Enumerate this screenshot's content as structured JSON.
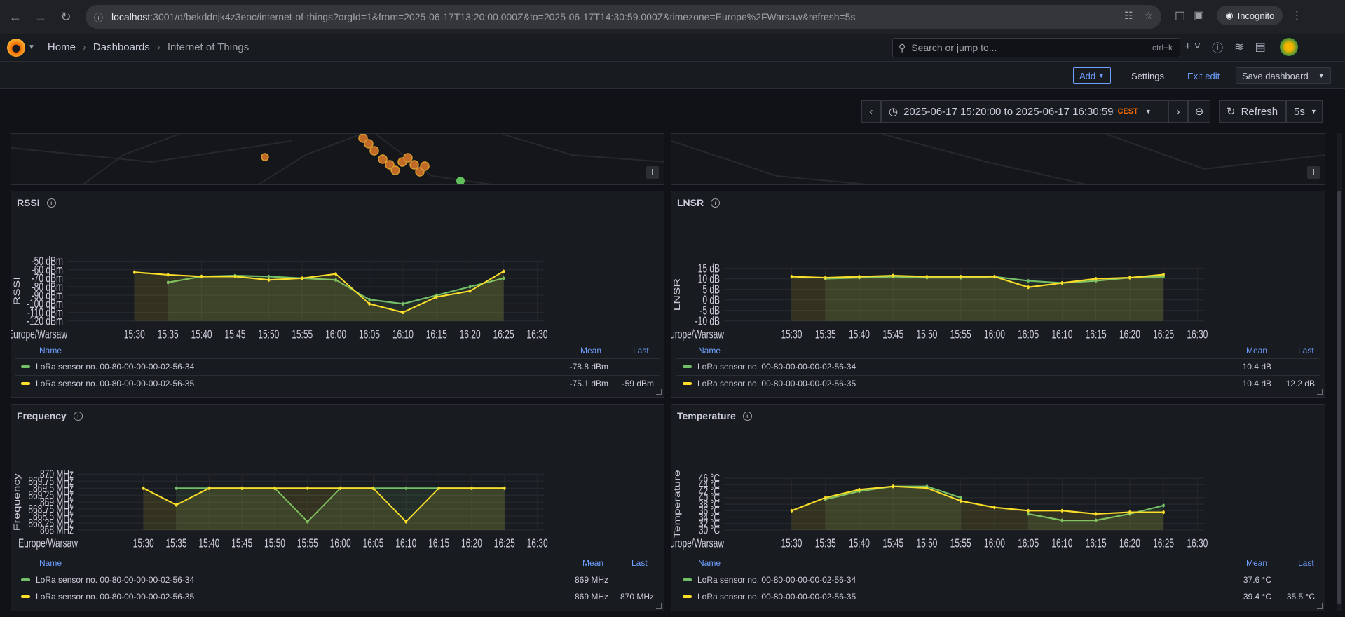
{
  "browser": {
    "url_host": "localhost",
    "url_rest": ":3001/d/bekddnjk4z3eoc/internet-of-things?orgId=1&from=2025-06-17T13:20:00.000Z&to=2025-06-17T14:30:59.000Z&timezone=Europe%2FWarsaw&refresh=5s",
    "incognito_label": "Incognito"
  },
  "nav": {
    "breadcrumbs": [
      "Home",
      "Dashboards",
      "Internet of Things"
    ],
    "search_placeholder": "Search or jump to...",
    "search_shortcut": "ctrl+k"
  },
  "toolbar": {
    "add_label": "Add",
    "settings_label": "Settings",
    "exit_label": "Exit edit",
    "save_label": "Save dashboard"
  },
  "timepicker": {
    "range": "2025-06-17 15:20:00 to 2025-06-17 16:30:59",
    "timezone": "CEST",
    "refresh_label": "Refresh",
    "refresh_interval": "5s"
  },
  "colors": {
    "series_34": "#73bf69",
    "series_35": "#fade2a",
    "link": "#6e9fff",
    "accent": "#f46800"
  },
  "x_axis": {
    "zone_label": "Europe/Warsaw",
    "ticks": [
      "15:30",
      "15:35",
      "15:40",
      "15:45",
      "15:50",
      "15:55",
      "16:00",
      "16:05",
      "16:10",
      "16:15",
      "16:20",
      "16:25",
      "16:30"
    ]
  },
  "legend_headers": {
    "name": "Name",
    "mean": "Mean",
    "last": "Last"
  },
  "panels": {
    "rssi": {
      "title": "RSSI",
      "ylabel": "RSSI",
      "yticks": [
        "-50 dBm",
        "-60 dBm",
        "-70 dBm",
        "-80 dBm",
        "-90 dBm",
        "-100 dBm",
        "-110 dBm",
        "-120 dBm"
      ],
      "legend": [
        {
          "name": "LoRa sensor no. 00-80-00-00-00-02-56-34",
          "mean": "-78.8 dBm",
          "last": ""
        },
        {
          "name": "LoRa sensor no. 00-80-00-00-00-02-56-35",
          "mean": "-75.1 dBm",
          "last": "-59 dBm"
        }
      ]
    },
    "lnsr": {
      "title": "LNSR",
      "ylabel": "LNSR",
      "yticks": [
        "15 dB",
        "10 dB",
        "5 dB",
        "0 dB",
        "-5 dB",
        "-10 dB"
      ],
      "legend": [
        {
          "name": "LoRa sensor no. 00-80-00-00-00-02-56-34",
          "mean": "10.4 dB",
          "last": ""
        },
        {
          "name": "LoRa sensor no. 00-80-00-00-00-02-56-35",
          "mean": "10.4 dB",
          "last": "12.2 dB"
        }
      ]
    },
    "frequency": {
      "title": "Frequency",
      "ylabel": "Frequency",
      "yticks": [
        "870 MHz",
        "869.75 MHz",
        "869.5 MHz",
        "869.25 MHz",
        "869 MHz",
        "868.75 MHz",
        "868.5 MHz",
        "868.25 MHz",
        "868 MHz"
      ],
      "legend": [
        {
          "name": "LoRa sensor no. 00-80-00-00-00-02-56-34",
          "mean": "869 MHz",
          "last": ""
        },
        {
          "name": "LoRa sensor no. 00-80-00-00-00-02-56-35",
          "mean": "869 MHz",
          "last": "870 MHz"
        }
      ]
    },
    "temperature": {
      "title": "Temperature",
      "ylabel": "Temperature",
      "yticks": [
        "46 °C",
        "44 °C",
        "42 °C",
        "40 °C",
        "38 °C",
        "36 °C",
        "34 °C",
        "32 °C",
        "30 °C"
      ],
      "legend": [
        {
          "name": "LoRa sensor no. 00-80-00-00-00-02-56-34",
          "mean": "37.6 °C",
          "last": ""
        },
        {
          "name": "LoRa sensor no. 00-80-00-00-00-02-56-35",
          "mean": "39.4 °C",
          "last": "35.5 °C"
        }
      ]
    }
  },
  "chart_data": [
    {
      "type": "line",
      "title": "RSSI",
      "ylabel": "RSSI",
      "ylim": [
        -120,
        -50
      ],
      "x": [
        "15:30",
        "15:35",
        "15:40",
        "15:45",
        "15:50",
        "15:55",
        "16:00",
        "16:05",
        "16:10",
        "16:15",
        "16:20",
        "16:25"
      ],
      "series": [
        {
          "name": "LoRa sensor no. 00-80-00-00-00-02-56-34",
          "values": [
            null,
            -75,
            -68,
            -67,
            -68,
            -70,
            -72,
            -95,
            -100,
            -90,
            -80,
            -70
          ]
        },
        {
          "name": "LoRa sensor no. 00-80-00-00-00-02-56-35",
          "values": [
            -63,
            -66,
            -68,
            -68,
            -72,
            -70,
            -65,
            -100,
            -110,
            -92,
            -85,
            -62
          ]
        }
      ]
    },
    {
      "type": "line",
      "title": "LNSR",
      "ylabel": "LNSR",
      "ylim": [
        -10,
        15
      ],
      "x": [
        "15:30",
        "15:35",
        "15:40",
        "15:45",
        "15:50",
        "15:55",
        "16:00",
        "16:05",
        "16:10",
        "16:15",
        "16:20",
        "16:25"
      ],
      "series": [
        {
          "name": "LoRa sensor no. 00-80-00-00-00-02-56-34",
          "values": [
            null,
            10,
            10.5,
            11,
            10.5,
            10.5,
            11,
            9,
            8,
            9,
            10.5,
            11
          ]
        },
        {
          "name": "LoRa sensor no. 00-80-00-00-00-02-56-35",
          "values": [
            11,
            10.5,
            11,
            11.5,
            11,
            11,
            11,
            6,
            8,
            10,
            10.5,
            12
          ]
        }
      ]
    },
    {
      "type": "line",
      "title": "Frequency",
      "ylabel": "Frequency",
      "ylim": [
        868,
        870
      ],
      "x": [
        "15:30",
        "15:35",
        "15:40",
        "15:45",
        "15:50",
        "15:55",
        "16:00",
        "16:05",
        "16:10",
        "16:15",
        "16:20",
        "16:25"
      ],
      "series": [
        {
          "name": "LoRa sensor no. 00-80-00-00-00-02-56-34",
          "values": [
            null,
            869.5,
            869.5,
            869.5,
            869.5,
            868.3,
            869.5,
            869.5,
            869.5,
            869.5,
            869.5,
            869.5
          ]
        },
        {
          "name": "LoRa sensor no. 00-80-00-00-00-02-56-35",
          "values": [
            869.5,
            868.9,
            869.5,
            869.5,
            869.5,
            869.5,
            869.5,
            869.5,
            868.3,
            869.5,
            869.5,
            869.5
          ]
        }
      ]
    },
    {
      "type": "line",
      "title": "Temperature",
      "ylabel": "Temperature",
      "ylim": [
        30,
        46
      ],
      "x": [
        "15:30",
        "15:35",
        "15:40",
        "15:45",
        "15:50",
        "15:55",
        "16:00",
        "16:05",
        "16:10",
        "16:15",
        "16:20",
        "16:25"
      ],
      "series": [
        {
          "name": "LoRa sensor no. 00-80-00-00-00-02-56-34",
          "values": [
            null,
            39.5,
            42,
            43.5,
            43.5,
            40,
            null,
            35,
            33,
            33,
            35,
            37.6
          ]
        },
        {
          "name": "LoRa sensor no. 00-80-00-00-00-02-56-35",
          "values": [
            36,
            40,
            42.5,
            43.5,
            43,
            39,
            37,
            36,
            36,
            35,
            35.5,
            35.5
          ]
        }
      ]
    }
  ]
}
